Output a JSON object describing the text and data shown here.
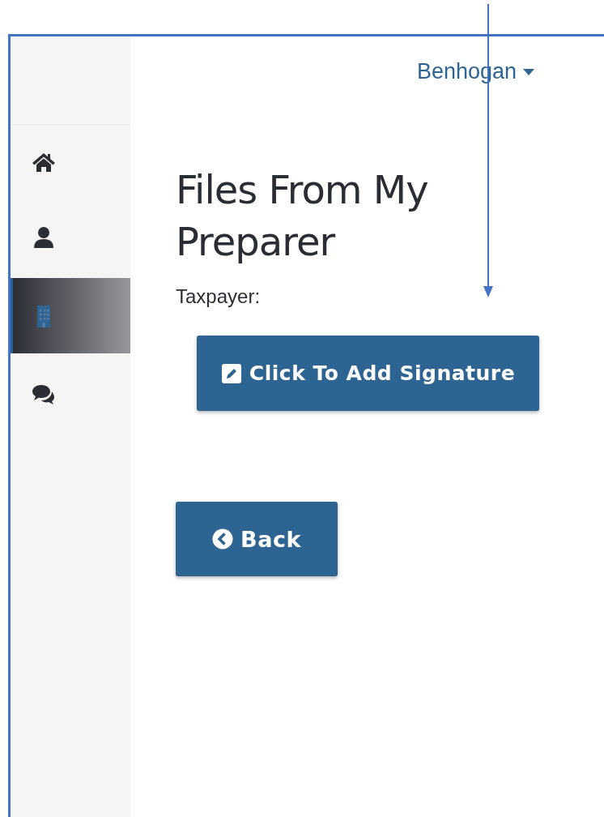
{
  "user_menu": {
    "label": "Benhogan"
  },
  "sidebar": {
    "items": [
      {
        "kind": "home",
        "selected": false
      },
      {
        "kind": "person",
        "selected": false
      },
      {
        "kind": "building",
        "selected": true
      },
      {
        "kind": "chat",
        "selected": false
      }
    ]
  },
  "page": {
    "title": "Files From My Preparer",
    "field_label": "Taxpayer:"
  },
  "buttons": [
    {
      "kind": "signature",
      "label": "Click To Add Signature"
    },
    {
      "kind": "back",
      "label": "Back"
    }
  ]
}
